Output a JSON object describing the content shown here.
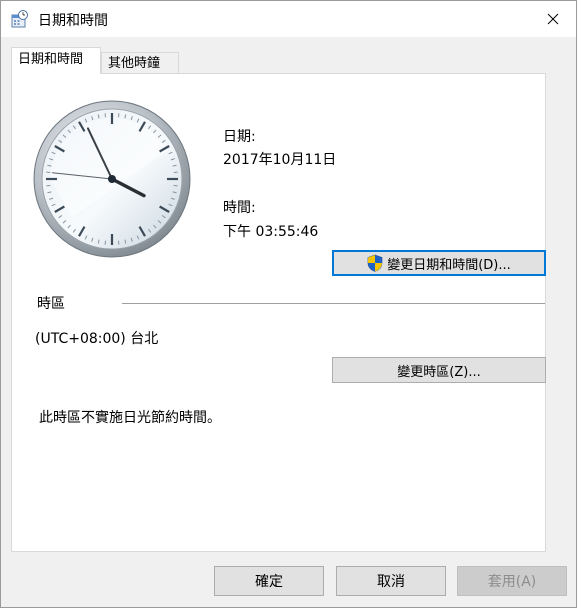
{
  "window": {
    "title": "日期和時間",
    "icon": "datetime-app-icon",
    "close_icon": "close-icon"
  },
  "tabs": [
    {
      "label": "日期和時間",
      "active": true
    },
    {
      "label": "其他時鐘",
      "active": false
    }
  ],
  "clock": {
    "time": "15:55:46"
  },
  "date": {
    "label": "日期:",
    "value": "2017年10月11日"
  },
  "time": {
    "label": "時間:",
    "value": "下午 03:55:46"
  },
  "change_datetime_button": {
    "label": "變更日期和時間(D)...",
    "icon": "uac-shield-icon"
  },
  "timezone": {
    "section_label": "時區",
    "value": "(UTC+08:00) 台北",
    "change_button_label": "變更時區(Z)..."
  },
  "dst_note": "此時區不實施日光節約時間。",
  "footer": {
    "ok_label": "確定",
    "cancel_label": "取消",
    "apply_label": "套用(A)"
  },
  "colors": {
    "accent": "#0078d7",
    "shield_blue": "#1f62c6",
    "shield_yellow": "#f5c400"
  }
}
